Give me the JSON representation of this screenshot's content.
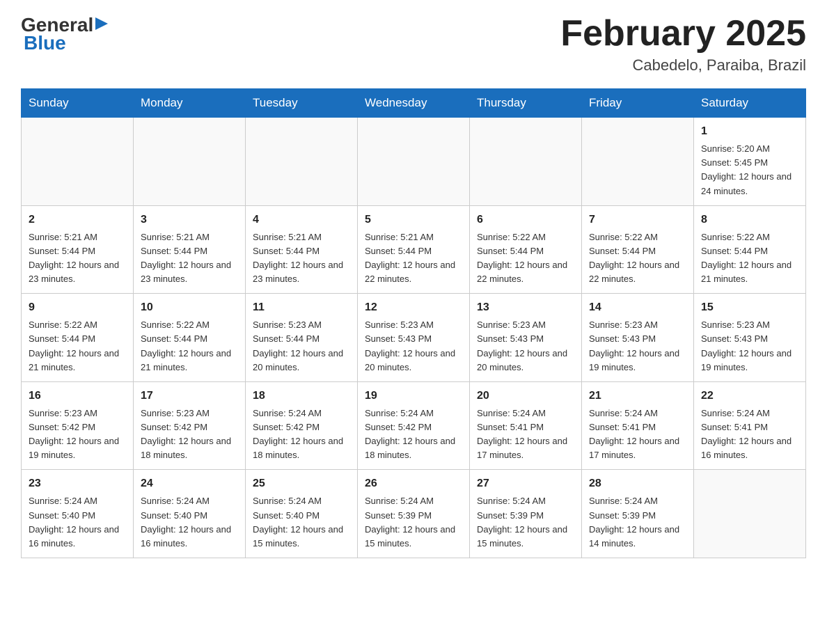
{
  "header": {
    "logo_general": "General",
    "logo_blue": "Blue",
    "month_title": "February 2025",
    "location": "Cabedelo, Paraiba, Brazil"
  },
  "days_of_week": [
    "Sunday",
    "Monday",
    "Tuesday",
    "Wednesday",
    "Thursday",
    "Friday",
    "Saturday"
  ],
  "weeks": [
    [
      {
        "day": "",
        "info": ""
      },
      {
        "day": "",
        "info": ""
      },
      {
        "day": "",
        "info": ""
      },
      {
        "day": "",
        "info": ""
      },
      {
        "day": "",
        "info": ""
      },
      {
        "day": "",
        "info": ""
      },
      {
        "day": "1",
        "info": "Sunrise: 5:20 AM\nSunset: 5:45 PM\nDaylight: 12 hours and 24 minutes."
      }
    ],
    [
      {
        "day": "2",
        "info": "Sunrise: 5:21 AM\nSunset: 5:44 PM\nDaylight: 12 hours and 23 minutes."
      },
      {
        "day": "3",
        "info": "Sunrise: 5:21 AM\nSunset: 5:44 PM\nDaylight: 12 hours and 23 minutes."
      },
      {
        "day": "4",
        "info": "Sunrise: 5:21 AM\nSunset: 5:44 PM\nDaylight: 12 hours and 23 minutes."
      },
      {
        "day": "5",
        "info": "Sunrise: 5:21 AM\nSunset: 5:44 PM\nDaylight: 12 hours and 22 minutes."
      },
      {
        "day": "6",
        "info": "Sunrise: 5:22 AM\nSunset: 5:44 PM\nDaylight: 12 hours and 22 minutes."
      },
      {
        "day": "7",
        "info": "Sunrise: 5:22 AM\nSunset: 5:44 PM\nDaylight: 12 hours and 22 minutes."
      },
      {
        "day": "8",
        "info": "Sunrise: 5:22 AM\nSunset: 5:44 PM\nDaylight: 12 hours and 21 minutes."
      }
    ],
    [
      {
        "day": "9",
        "info": "Sunrise: 5:22 AM\nSunset: 5:44 PM\nDaylight: 12 hours and 21 minutes."
      },
      {
        "day": "10",
        "info": "Sunrise: 5:22 AM\nSunset: 5:44 PM\nDaylight: 12 hours and 21 minutes."
      },
      {
        "day": "11",
        "info": "Sunrise: 5:23 AM\nSunset: 5:44 PM\nDaylight: 12 hours and 20 minutes."
      },
      {
        "day": "12",
        "info": "Sunrise: 5:23 AM\nSunset: 5:43 PM\nDaylight: 12 hours and 20 minutes."
      },
      {
        "day": "13",
        "info": "Sunrise: 5:23 AM\nSunset: 5:43 PM\nDaylight: 12 hours and 20 minutes."
      },
      {
        "day": "14",
        "info": "Sunrise: 5:23 AM\nSunset: 5:43 PM\nDaylight: 12 hours and 19 minutes."
      },
      {
        "day": "15",
        "info": "Sunrise: 5:23 AM\nSunset: 5:43 PM\nDaylight: 12 hours and 19 minutes."
      }
    ],
    [
      {
        "day": "16",
        "info": "Sunrise: 5:23 AM\nSunset: 5:42 PM\nDaylight: 12 hours and 19 minutes."
      },
      {
        "day": "17",
        "info": "Sunrise: 5:23 AM\nSunset: 5:42 PM\nDaylight: 12 hours and 18 minutes."
      },
      {
        "day": "18",
        "info": "Sunrise: 5:24 AM\nSunset: 5:42 PM\nDaylight: 12 hours and 18 minutes."
      },
      {
        "day": "19",
        "info": "Sunrise: 5:24 AM\nSunset: 5:42 PM\nDaylight: 12 hours and 18 minutes."
      },
      {
        "day": "20",
        "info": "Sunrise: 5:24 AM\nSunset: 5:41 PM\nDaylight: 12 hours and 17 minutes."
      },
      {
        "day": "21",
        "info": "Sunrise: 5:24 AM\nSunset: 5:41 PM\nDaylight: 12 hours and 17 minutes."
      },
      {
        "day": "22",
        "info": "Sunrise: 5:24 AM\nSunset: 5:41 PM\nDaylight: 12 hours and 16 minutes."
      }
    ],
    [
      {
        "day": "23",
        "info": "Sunrise: 5:24 AM\nSunset: 5:40 PM\nDaylight: 12 hours and 16 minutes."
      },
      {
        "day": "24",
        "info": "Sunrise: 5:24 AM\nSunset: 5:40 PM\nDaylight: 12 hours and 16 minutes."
      },
      {
        "day": "25",
        "info": "Sunrise: 5:24 AM\nSunset: 5:40 PM\nDaylight: 12 hours and 15 minutes."
      },
      {
        "day": "26",
        "info": "Sunrise: 5:24 AM\nSunset: 5:39 PM\nDaylight: 12 hours and 15 minutes."
      },
      {
        "day": "27",
        "info": "Sunrise: 5:24 AM\nSunset: 5:39 PM\nDaylight: 12 hours and 15 minutes."
      },
      {
        "day": "28",
        "info": "Sunrise: 5:24 AM\nSunset: 5:39 PM\nDaylight: 12 hours and 14 minutes."
      },
      {
        "day": "",
        "info": ""
      }
    ]
  ]
}
